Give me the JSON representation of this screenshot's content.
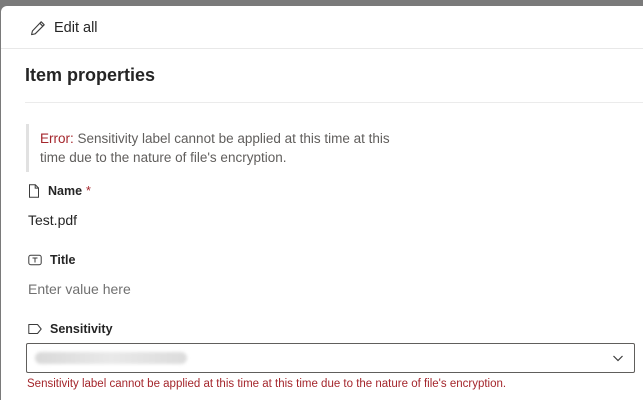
{
  "toolbar": {
    "edit_all_label": "Edit all",
    "edit_icon": "pencil-icon"
  },
  "section": {
    "title": "Item properties"
  },
  "error_banner": {
    "prefix": "Error:",
    "line1": " Sensitivity label cannot be applied at this time at this",
    "line2": "time due to the nature of file's encryption."
  },
  "fields": {
    "name": {
      "icon": "document-icon",
      "label": "Name",
      "required_mark": "*",
      "value": "Test.pdf"
    },
    "title": {
      "icon": "text-field-icon",
      "label": "Title",
      "placeholder": "Enter value here"
    },
    "sensitivity": {
      "icon": "tag-icon",
      "label": "Sensitivity",
      "selected_value_redacted": true,
      "chevron_icon": "chevron-down-icon",
      "error": "Sensitivity label cannot be applied at this time at this time due to the nature of file's encryption."
    }
  },
  "colors": {
    "error_red": "#a4262c",
    "text": "#252525",
    "placeholder": "#707070",
    "backdrop": "#7a7a7a"
  }
}
